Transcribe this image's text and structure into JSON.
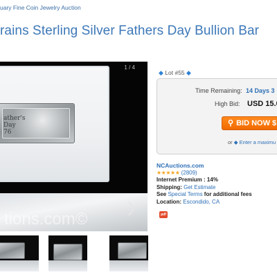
{
  "breadcrumb": "uary Fine Coin Jewelry Auction",
  "title": "rains Sterling Silver Fathers Day Bullion Bar",
  "viewer": {
    "counter": "1 / 4",
    "bar_text_line1": "ather's",
    "bar_text_line2": "Day",
    "bar_text_line3": "76",
    "watermark": "tions.com©"
  },
  "lot": {
    "label": "Lot #55"
  },
  "bidbox": {
    "time_label": "Time Remaining:",
    "time_value": "14 Days 3",
    "bid_label": "High Bid:",
    "bid_value": "USD 15.0",
    "bid_button": "BID NOW $",
    "or_text": "or",
    "max_link": "Enter a maximu"
  },
  "seller": {
    "house": "NCAuctions.com",
    "stars": "★★★★★",
    "rating": "(2809)",
    "premium_label": "Internet Premium :",
    "premium_value": "14%",
    "shipping_label": "Shipping:",
    "shipping_link": "Get Estimate",
    "see_text": "See",
    "special_terms": "Special Terms",
    "fees_text": "for additional fees",
    "location_label": "Location:",
    "location_value": "Escondido, CA"
  },
  "badge_text": "pdf",
  "colors": {
    "link": "#3d78b8",
    "accent": "#f26a00",
    "star": "#f5a623"
  }
}
